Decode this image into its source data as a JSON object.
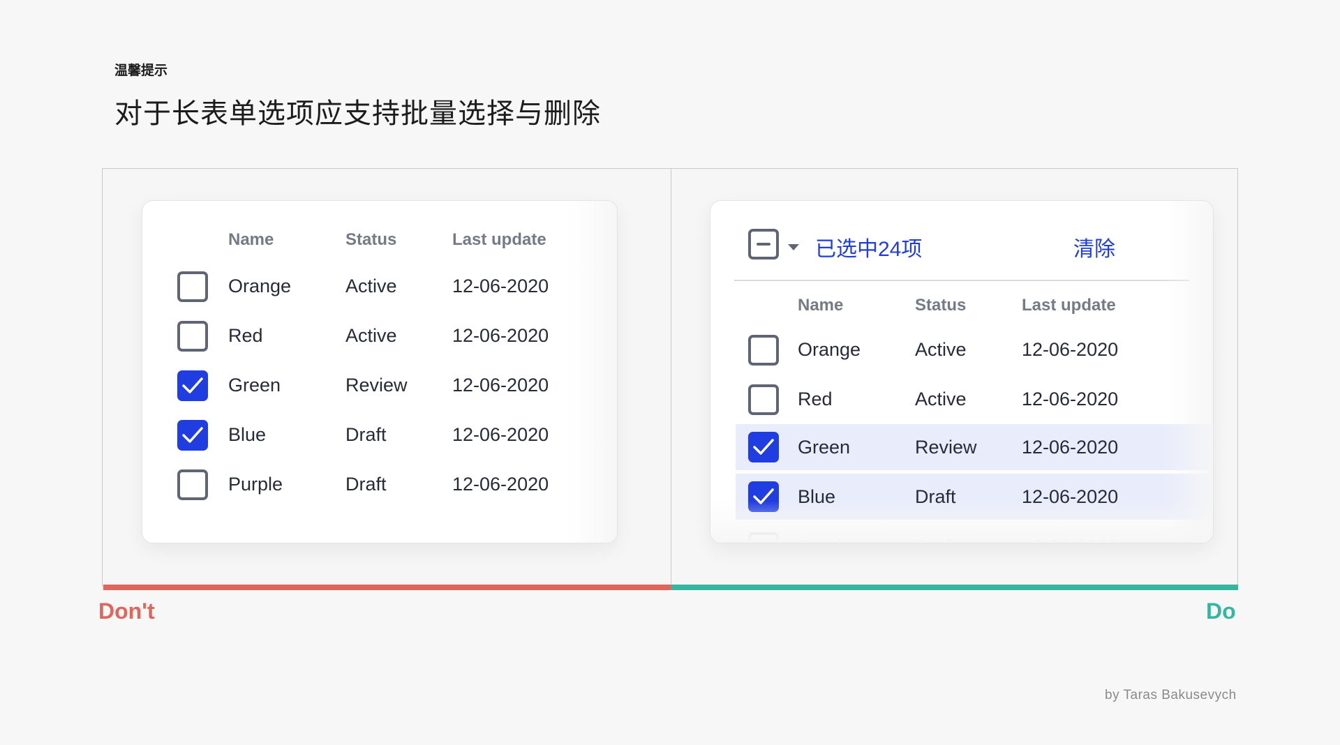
{
  "page": {
    "tip_label": "温馨提示",
    "headline": "对于长表单选项应支持批量选择与删除",
    "credit": "by Taras Bakusevych"
  },
  "labels": {
    "dont": "Don't",
    "do": "Do"
  },
  "colors": {
    "dont": "#e0655b",
    "do": "#35b6a0",
    "accent": "#1f3de0",
    "selected_row": "#e9edfb"
  },
  "table": {
    "columns": [
      "Name",
      "Status",
      "Last update"
    ],
    "rows": [
      {
        "name": "Orange",
        "status": "Active",
        "date": "12-06-2020",
        "checked": false
      },
      {
        "name": "Red",
        "status": "Active",
        "date": "12-06-2020",
        "checked": false
      },
      {
        "name": "Green",
        "status": "Review",
        "date": "12-06-2020",
        "checked": true
      },
      {
        "name": "Blue",
        "status": "Draft",
        "date": "12-06-2020",
        "checked": true
      },
      {
        "name": "Purple",
        "status": "Draft",
        "date": "12-06-2020",
        "checked": false
      }
    ]
  },
  "bulk": {
    "selected_text": "已选中24项",
    "clear_label": "清除",
    "icons": [
      "indeterminate-checkbox-icon",
      "chevron-down-icon"
    ]
  }
}
